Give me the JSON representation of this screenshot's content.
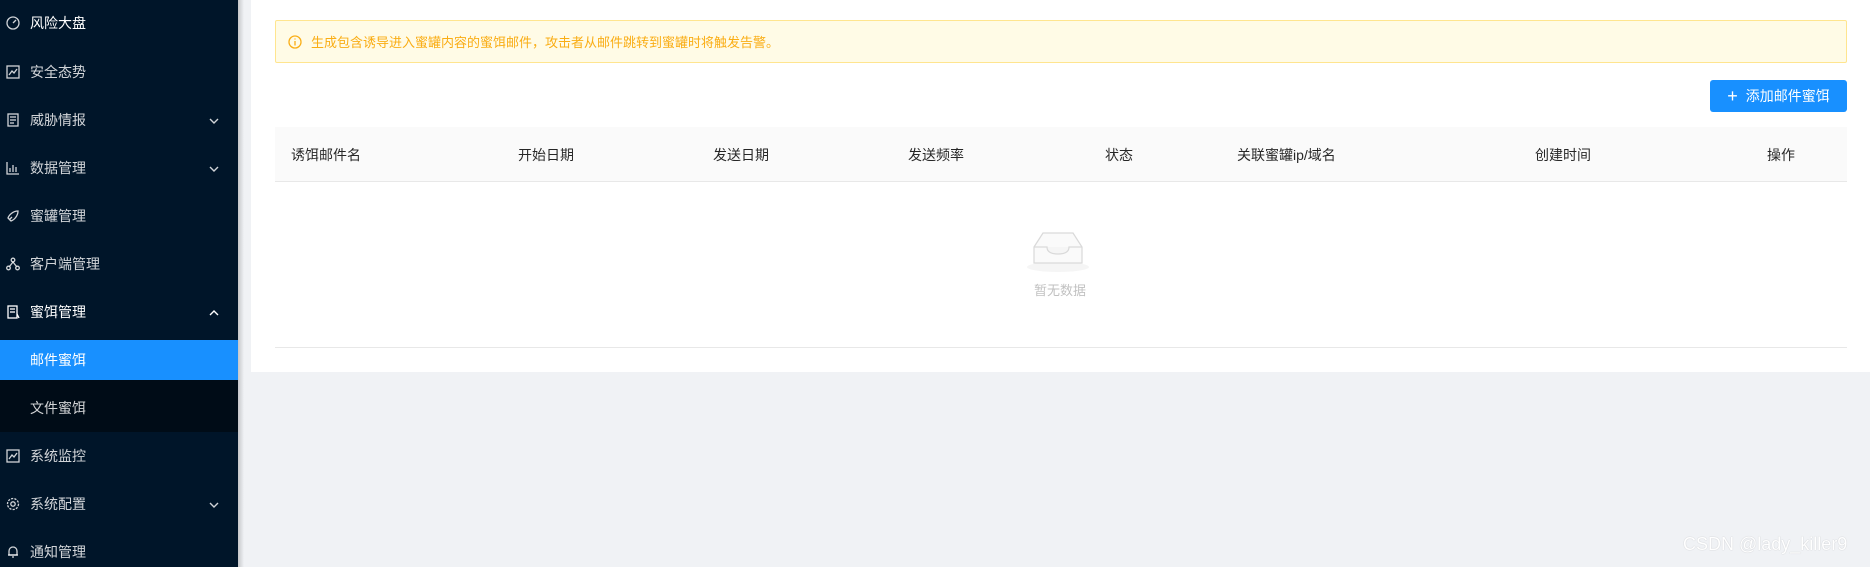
{
  "sidebar": {
    "items": [
      {
        "label": "风险大盘",
        "icon": "dashboard-icon"
      },
      {
        "label": "安全态势",
        "icon": "line-chart-icon"
      },
      {
        "label": "威胁情报",
        "icon": "document-icon"
      },
      {
        "label": "数据管理",
        "icon": "bar-chart-icon"
      },
      {
        "label": "蜜罐管理",
        "icon": "rocket-icon"
      },
      {
        "label": "客户端管理",
        "icon": "cluster-icon"
      },
      {
        "label": "蜜饵管理",
        "icon": "file-text-icon"
      },
      {
        "label": "系统监控",
        "icon": "monitor-chart-icon"
      },
      {
        "label": "系统配置",
        "icon": "gear-icon"
      },
      {
        "label": "通知管理",
        "icon": "bell-icon"
      }
    ],
    "subitems": [
      {
        "label": "邮件蜜饵",
        "active": true
      },
      {
        "label": "文件蜜饵",
        "active": false
      }
    ],
    "active_color": "#1890ff",
    "background": "#001529"
  },
  "alert": {
    "text": "生成包含诱导进入蜜罐内容的蜜饵邮件，攻击者从邮件跳转到蜜罐时将触发告警。",
    "icon": "info-circle-icon",
    "color": "#faad14"
  },
  "toolbar": {
    "add_label": "添加邮件蜜饵",
    "add_icon": "plus-icon"
  },
  "table": {
    "columns": [
      "诱饵邮件名",
      "开始日期",
      "发送日期",
      "发送频率",
      "状态",
      "关联蜜罐ip/域名",
      "创建时间",
      "操作"
    ],
    "empty_text": "暂无数据"
  },
  "watermark": "CSDN @lady_killer9"
}
